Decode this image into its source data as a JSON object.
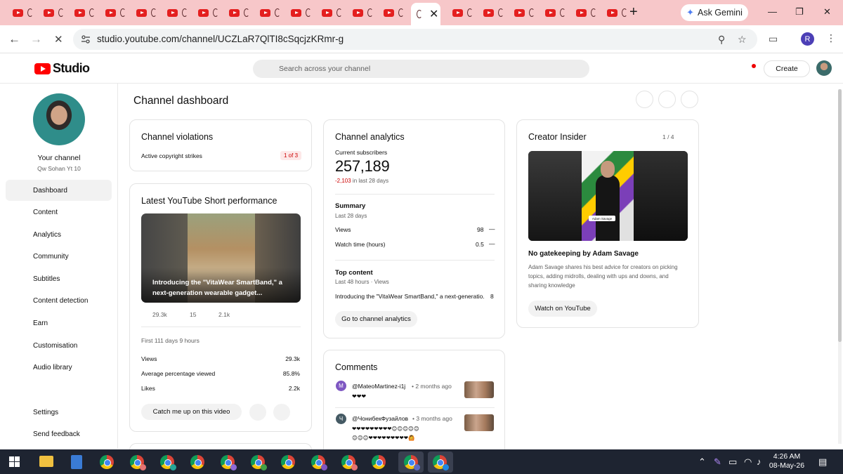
{
  "browser": {
    "tab_count": 20,
    "new_tab_label": "+",
    "ask_gemini": "Ask Gemini",
    "url": "studio.youtube.com/channel/UCZLaR7QlTI8cSqcjzKRmr-g",
    "profile_initial": "R"
  },
  "studio": {
    "logo_text": "Studio",
    "search_placeholder": "Search across your channel",
    "create_label": "Create"
  },
  "sidebar": {
    "channel_label": "Your channel",
    "channel_handle": "Qw Sohan Yt 10",
    "items": [
      {
        "label": "Dashboard",
        "active": true
      },
      {
        "label": "Content"
      },
      {
        "label": "Analytics"
      },
      {
        "label": "Community"
      },
      {
        "label": "Subtitles"
      },
      {
        "label": "Content detection"
      },
      {
        "label": "Earn"
      },
      {
        "label": "Customisation"
      },
      {
        "label": "Audio library"
      }
    ],
    "settings": "Settings",
    "feedback": "Send feedback"
  },
  "dashboard": {
    "title": "Channel dashboard",
    "violations": {
      "title": "Channel violations",
      "row_label": "Active copyright strikes",
      "badge": "1 of 3"
    },
    "short_perf": {
      "title": "Latest YouTube Short performance",
      "caption": "Introducing the \"VitaWear SmartBand,\" a next-generation wearable gadget...",
      "quick_stats": [
        "29.3k",
        "15",
        "2.1k"
      ],
      "period": "First 111 days 9 hours",
      "rows": [
        {
          "label": "Views",
          "value": "29.3k"
        },
        {
          "label": "Average percentage viewed",
          "value": "85.8%"
        },
        {
          "label": "Likes",
          "value": "2.2k"
        }
      ],
      "catch_up": "Catch me up on this video"
    },
    "analytics": {
      "title": "Channel analytics",
      "subs_label": "Current subscribers",
      "subs_value": "257,189",
      "subs_change": "-2,103",
      "subs_change_suffix": "in last 28 days",
      "summary_title": "Summary",
      "summary_period": "Last 28 days",
      "summary_rows": [
        {
          "label": "Views",
          "value": "98",
          "trend": "—"
        },
        {
          "label": "Watch time (hours)",
          "value": "0.5",
          "trend": "—"
        }
      ],
      "top_title": "Top content",
      "top_period": "Last 48 hours · Views",
      "top_item": "Introducing the \"VitaWear SmartBand,\" a next-generatio...",
      "top_value": "8",
      "button": "Go to channel analytics"
    },
    "comments": {
      "title": "Comments",
      "items": [
        {
          "initial": "M",
          "color": "#7e57c2",
          "author": "@MateoMartinez-i1j",
          "time": "• 2 months ago",
          "text": "❤❤❤"
        },
        {
          "initial": "Ч",
          "color": "#455a64",
          "author": "@ЧонибекФузайлов",
          "time": "• 3 months ago",
          "text": "❤❤❤❤❤❤❤❤❤😊😊😊😊😊",
          "text2": "😊😊😊❤❤❤❤❤❤❤❤❤🙆"
        }
      ]
    },
    "creator_insider": {
      "title": "Creator Insider",
      "page": "1 / 4",
      "tag": "Adam Savage",
      "video_title": "No gatekeeping by Adam Savage",
      "desc": "Adam Savage shares his best advice for creators on picking topics, adding midrolls, dealing with ups and downs, and sharing knowledge",
      "button": "Watch on YouTube"
    }
  },
  "taskbar": {
    "time": "4:26 AM",
    "date": "08-May-26"
  }
}
